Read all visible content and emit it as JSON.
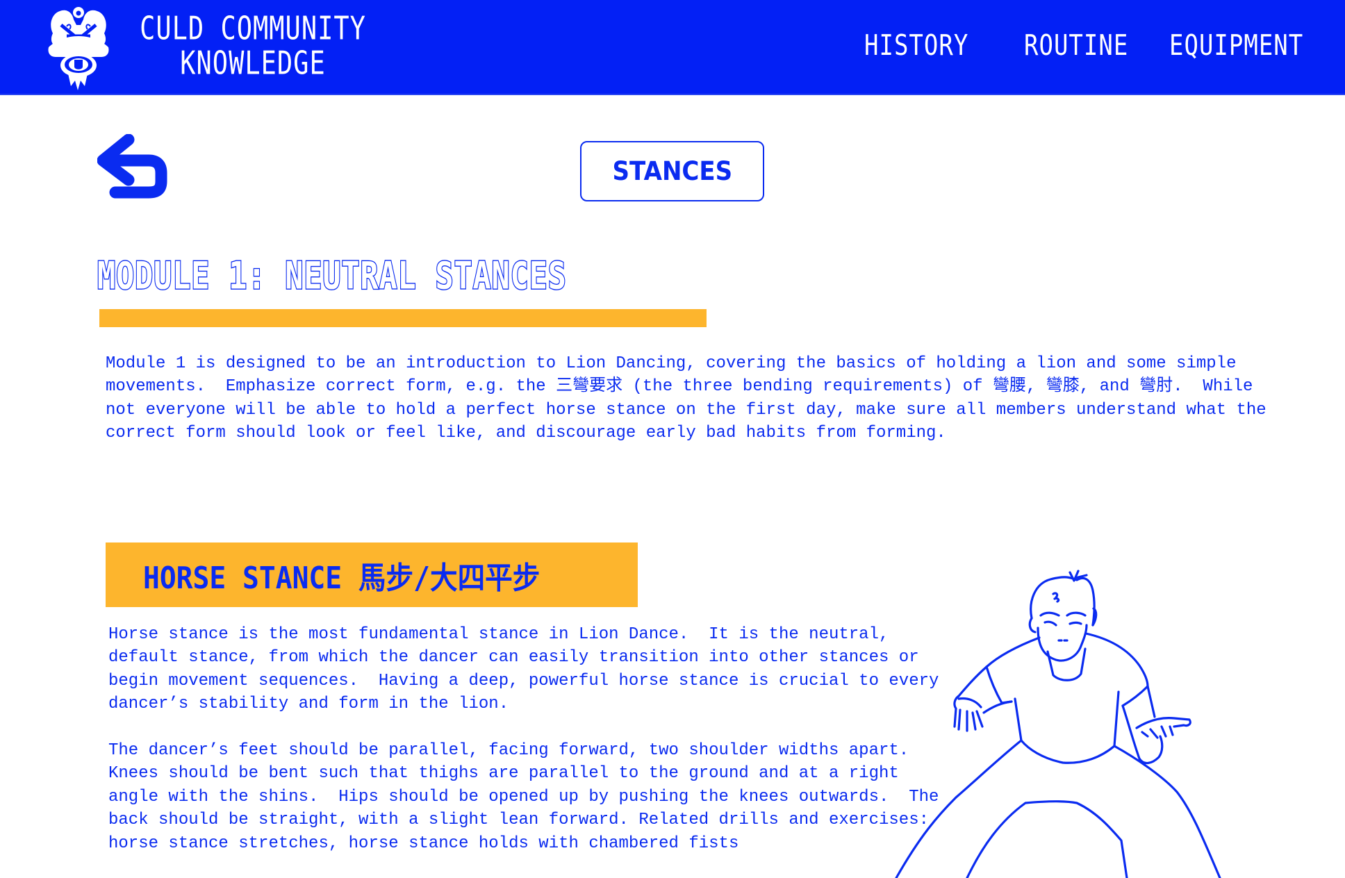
{
  "header": {
    "logo_icon": "lion-head-logo-icon",
    "title_line1": "CULD COMMUNITY",
    "title_line2": "KNOWLEDGE",
    "nav": [
      {
        "label": "HISTORY"
      },
      {
        "label": "ROUTINE"
      },
      {
        "label": "EQUIPMENT"
      }
    ]
  },
  "toolbar": {
    "back_icon": "back-arrow-icon",
    "section_label": "STANCES"
  },
  "module": {
    "title": "MODULE 1: NEUTRAL STANCES",
    "intro": "Module 1 is designed to be an introduction to Lion Dancing, covering the basics of holding a lion and some simple movements.  Emphasize correct form, e.g. the 三彎要求 (the three bending requirements) of 彎腰, 彎膝, and 彎肘.  While not everyone will be able to hold a perfect horse stance on the first day, make sure all members understand what the correct form should look or feel like, and discourage early bad habits from forming."
  },
  "stance": {
    "heading": "HORSE STANCE 馬步/大四平步",
    "paragraph1": "Horse stance is the most fundamental stance in Lion Dance.  It is the neutral, default stance, from which the dancer can easily transition into other stances or begin movement sequences.  Having a deep, powerful horse stance is crucial to every dancer’s stability and form in the lion.",
    "paragraph2": "The dancer’s feet should be parallel, facing forward, two shoulder widths apart.  Knees should be bent such that thighs are parallel to the ground and at a right angle with the shins.  Hips should be opened up by pushing the knees outwards.  The back should be straight, with a slight lean forward. Related drills and exercises: horse stance stretches, horse stance holds with chambered fists",
    "illustration": "horse-stance-figure-illustration"
  },
  "colors": {
    "brand_blue": "#0320F5",
    "text_blue": "#0A2BF0",
    "accent_orange": "#FDB52D",
    "background": "#FFFFFF"
  }
}
